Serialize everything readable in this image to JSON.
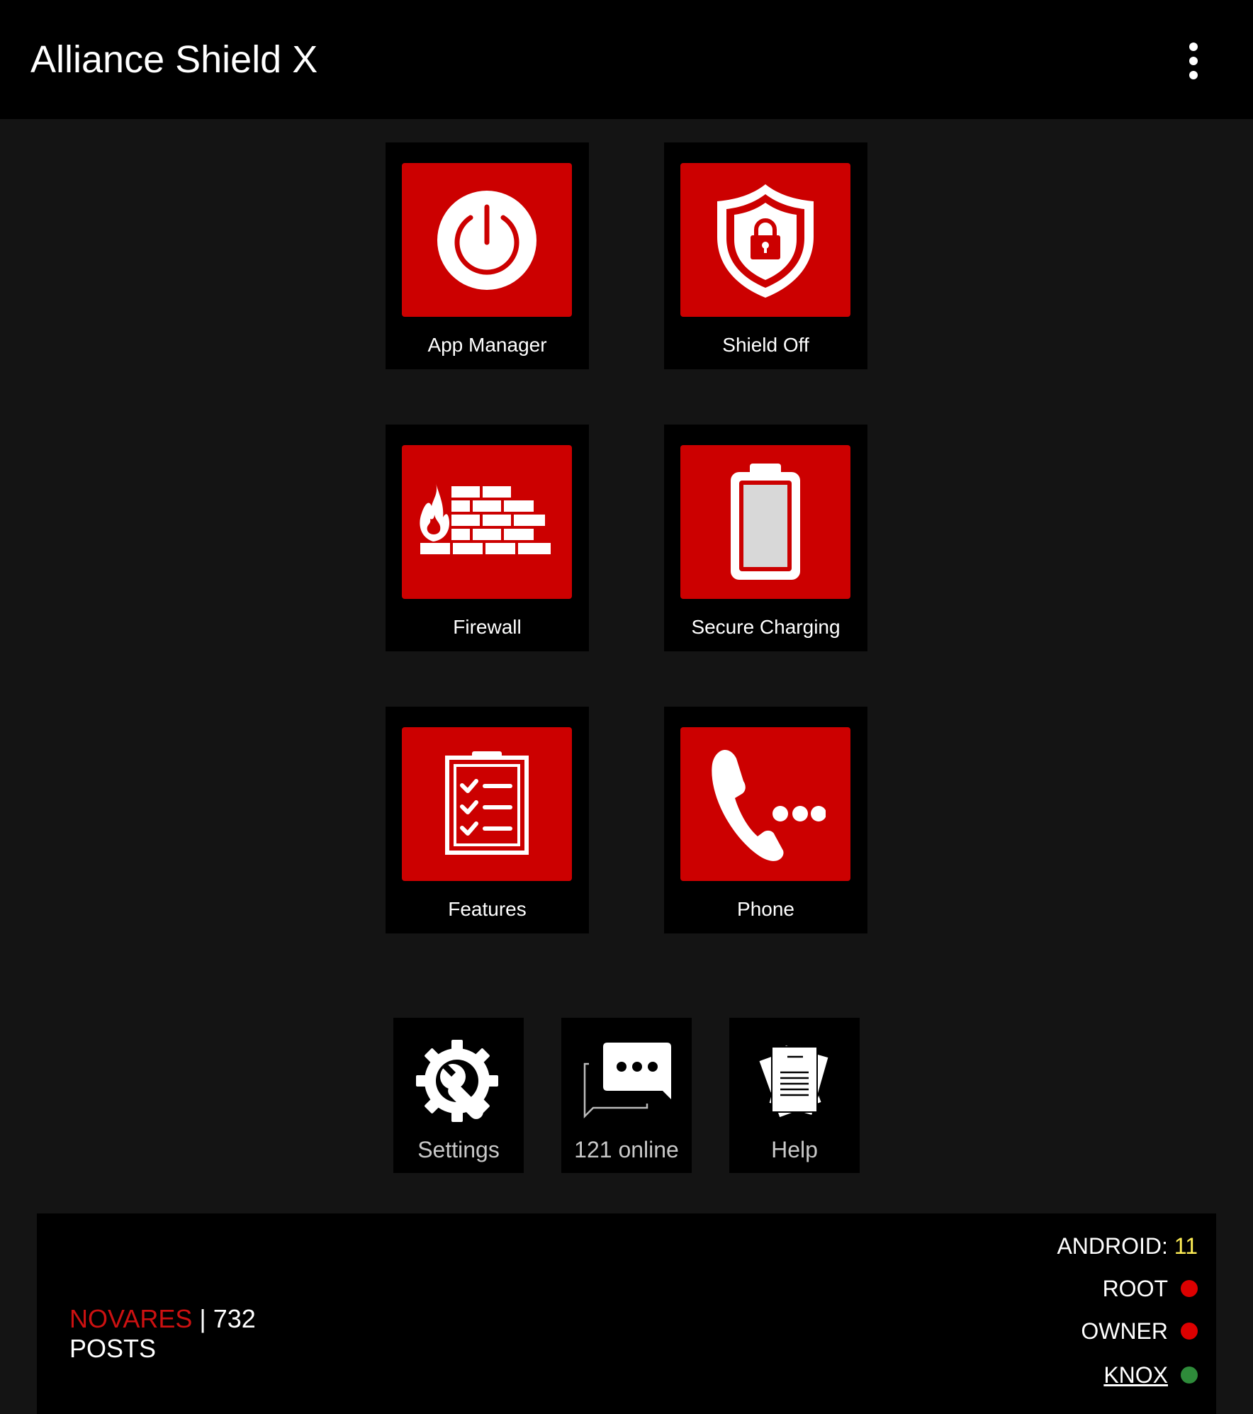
{
  "app": {
    "title": "Alliance Shield X",
    "menu_icon": "more-vert-icon"
  },
  "tiles": [
    {
      "label": "App Manager",
      "icon": "power-icon"
    },
    {
      "label": "Shield Off",
      "icon": "shield-lock-icon"
    },
    {
      "label": "Firewall",
      "icon": "firewall-icon"
    },
    {
      "label": "Secure Charging",
      "icon": "battery-icon"
    },
    {
      "label": "Features",
      "icon": "checklist-icon"
    },
    {
      "label": "Phone",
      "icon": "phone-call-icon"
    }
  ],
  "shortcuts": [
    {
      "label": "Settings",
      "icon": "gear-wrench-icon"
    },
    {
      "label": "121 online",
      "icon": "chat-bubbles-icon"
    },
    {
      "label": "Help",
      "icon": "documents-icon"
    }
  ],
  "footer": {
    "forum_brand": "NOVARES",
    "separator": "|",
    "post_count": "732",
    "posts_label": "POSTS",
    "android_label": "ANDROID:",
    "android_version": "11",
    "statuses": [
      {
        "label": "ROOT",
        "color": "#dd0000"
      },
      {
        "label": "OWNER",
        "color": "#dd0000"
      },
      {
        "label": "KNOX",
        "color": "#2e8b3a"
      }
    ]
  },
  "colors": {
    "accent": "#cc0000",
    "background": "#141414",
    "tile_background": "#000000",
    "android_version": "#ffee55"
  }
}
